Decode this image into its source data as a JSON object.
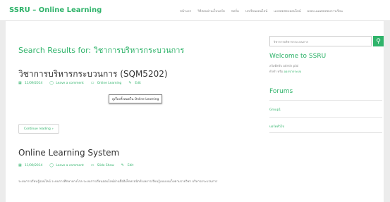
{
  "header": {
    "brand": "SSRU – Online Learning",
    "nav": [
      "หน้าแรก",
      "วิธีสอบผ่านเว็บบอร์ด",
      "ฟอรั่ม",
      "บทเรียนออนไลน์",
      "แบบทดสอบออนไลน์",
      "ผลคะแนนทดสอบการเรียน"
    ]
  },
  "main": {
    "search_heading": "Search Results for: วิชาการบริหารกระบวนการ",
    "posts": [
      {
        "title": "วิชาการบริหารกระบวนการ (SQM5202)",
        "date": "11/09/2014",
        "comments": "Leave a comment",
        "category": "Online Learning",
        "edit": "Edit",
        "more": "Continue reading",
        "tooltip": "ดูเรื่องทั้งหมดใน Online Learning"
      },
      {
        "title": "Online Learning System",
        "date": "11/09/2014",
        "comments": "Leave a comment",
        "category": "Slide Show",
        "edit": "Edit",
        "excerpt": "ระบบการเรียนรู้ออนไลน์ ระบบการศึกษาทางไกล ระบบการเรียนออนไลน์ผ่านสื่ออิเล็กทรอนิกส์ ผลการเรียนรู้แบบบนเว็บตามรายวิชา บริหารกระบวนการ"
      }
    ]
  },
  "sidebar": {
    "search_value": "วิชาการบริหารกระบวนการ",
    "welcome_heading": "Welcome to SSRU",
    "welcome_line1": "สวัสดีครับ admin plai",
    "welcome_line2_prefix": "ท้าทำ หรือ ",
    "welcome_line2_link": "ออกจากระบบ",
    "forums_heading": "Forums",
    "forums": [
      "Group1",
      "บอร์ดทั่วไป"
    ]
  },
  "colors": {
    "accent": "#2fb36a",
    "background": "#ececec"
  },
  "icons": {
    "search": "magnifier-icon",
    "calendar": "calendar-icon",
    "comment": "comment-bubble-icon",
    "folder": "folder-icon",
    "edit": "pencil-icon",
    "chevron": "chevron-right-icon"
  }
}
